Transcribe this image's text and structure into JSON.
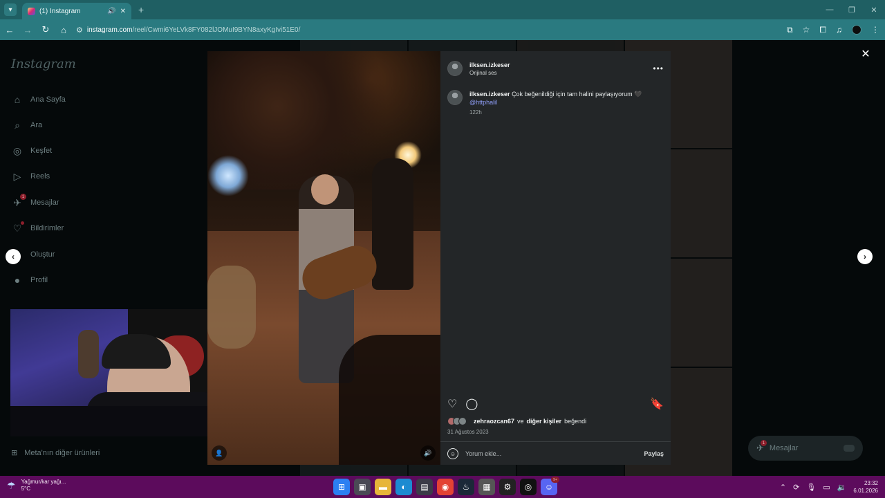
{
  "browser": {
    "tab_title": "(1) Instagram",
    "new_tab": "+",
    "url_domain": "instagram.com",
    "url_path": "/reel/Cwmi6YeLVk8FY082lJOMuI9BYN8axyKgIvi51E0/"
  },
  "sidebar": {
    "logo": "Instagram",
    "items": [
      {
        "label": "Ana Sayfa",
        "icon": "home-icon"
      },
      {
        "label": "Ara",
        "icon": "search-icon"
      },
      {
        "label": "Keşfet",
        "icon": "compass-icon"
      },
      {
        "label": "Reels",
        "icon": "reels-icon"
      },
      {
        "label": "Mesajlar",
        "icon": "messenger-icon",
        "badge": "1"
      },
      {
        "label": "Bildirimler",
        "icon": "heart-icon"
      },
      {
        "label": "Oluştur",
        "icon": "plus-icon"
      },
      {
        "label": "Profil",
        "icon": "profile-avatar"
      }
    ],
    "more": "Meta'nın diğer ürünleri"
  },
  "post": {
    "username": "ilksen.izkeser",
    "audio": "Orijinal ses",
    "caption_user": "ilksen.izkeser",
    "caption_text": "Çok beğenildiği için tam halini paylaşıyorum 🖤",
    "mention": "@httphalil",
    "caption_time": "122h",
    "likes_user": "zehraozcan67",
    "likes_and": "ve",
    "likes_others": "diğer kişiler",
    "likes_suffix": "beğendi",
    "date": "31 Ağustos 2023",
    "comment_placeholder": "Yorum ekle...",
    "post_label": "Paylaş"
  },
  "floating_messages": {
    "label": "Mesajlar",
    "badge": "1"
  },
  "taskbar": {
    "weather_text": "Yağmur/kar yağı...",
    "temperature": "5°C",
    "time": "23:32",
    "date": "6.01.2026",
    "discord_badge": "9+"
  },
  "colors": {
    "tab_bar": "#1f5f63",
    "toolbar": "#2a7a80",
    "taskbar": "#5c0b5c",
    "panel": "#232628",
    "mention": "#8f9ef8"
  }
}
